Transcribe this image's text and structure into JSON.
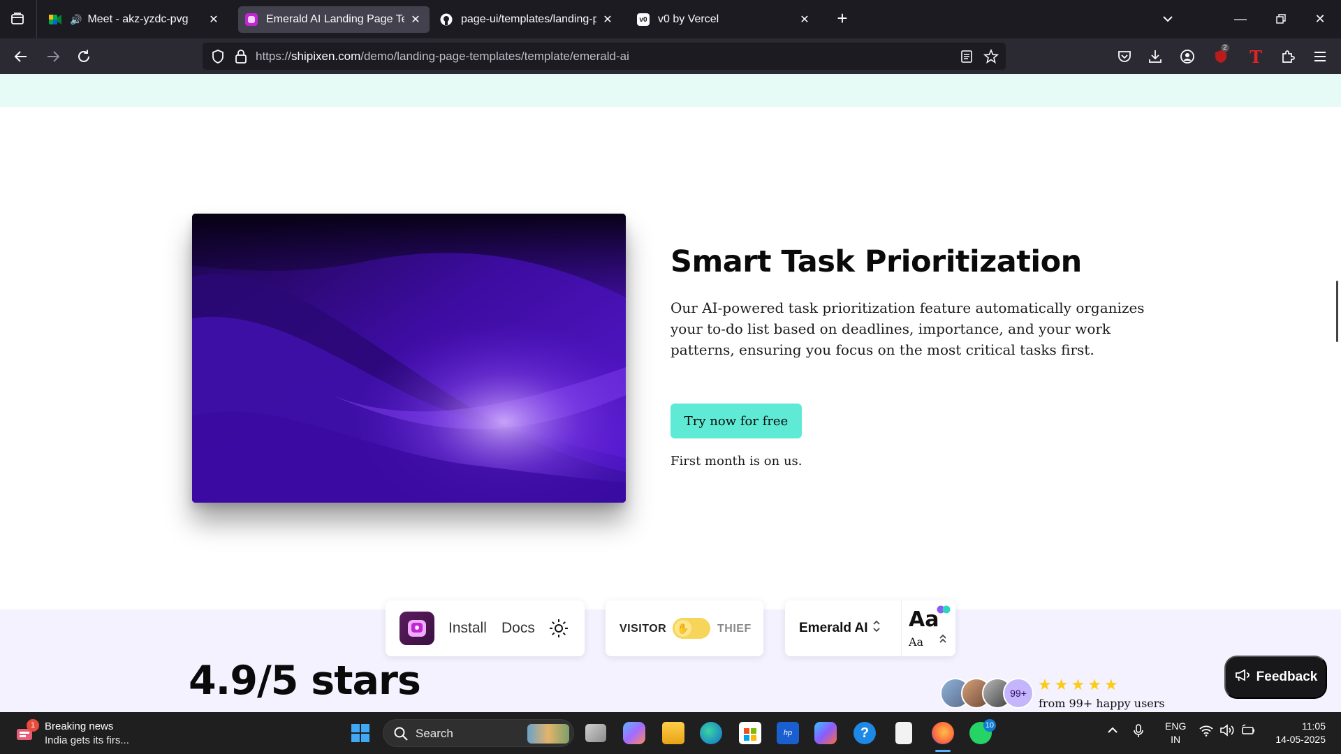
{
  "browser": {
    "tabs": [
      {
        "title": "Meet - akz-yzdc-pvg",
        "favicon": "google-meet-icon",
        "audio": true,
        "active": false
      },
      {
        "title": "Emerald AI Landing Page Templ",
        "favicon": "shipixen-icon",
        "active": true
      },
      {
        "title": "page-ui/templates/landing-pag",
        "favicon": "github-icon",
        "active": false
      },
      {
        "title": "v0 by Vercel",
        "favicon": "v0-icon",
        "active": false
      }
    ],
    "url_prefix": "https://",
    "url_host": "shipixen.com",
    "url_path": "/demo/landing-page-templates/template/emerald-ai",
    "extension_badge": "2"
  },
  "page": {
    "feature": {
      "title": "Smart Task Prioritization",
      "description": "Our AI-powered task prioritization feature automatically organizes your to-do list based on deadlines, importance, and your work patterns, ensuring you focus on the most critical tasks first.",
      "cta_label": "Try now for free",
      "cta_note": "First month is on us."
    },
    "rating_heading": "4.9/5 stars",
    "toolbar": {
      "install_label": "Install",
      "docs_label": "Docs",
      "visitor_label": "VISITOR",
      "thief_label": "THIEF",
      "theme_name": "Emerald AI",
      "font_big": "Aa",
      "font_small": "Aa"
    },
    "social_proof": {
      "more_count": "99+",
      "stars": 5,
      "caption": "from 99+ happy users"
    },
    "feedback_label": "Feedback",
    "colors": {
      "accent": "#5eead4",
      "top_strip": "#e6fbf5",
      "band": "#f4f2fe",
      "star": "#facc15"
    }
  },
  "taskbar": {
    "news_title": "Breaking news",
    "news_sub": "India gets its firs...",
    "news_badge": "1",
    "search_label": "Search",
    "whatsapp_badge": "10",
    "lang_1": "ENG",
    "lang_2": "IN",
    "time": "11:05",
    "date": "14-05-2025"
  }
}
